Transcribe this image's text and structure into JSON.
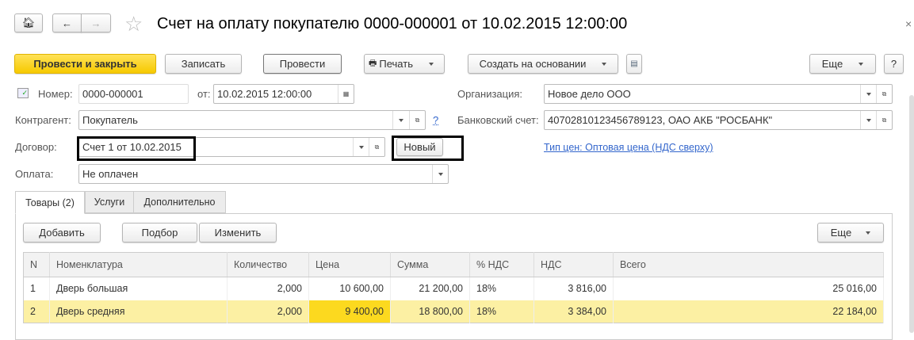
{
  "title": "Счет на оплату покупателю 0000-000001 от 10.02.2015 12:00:00",
  "toolbar": {
    "post_close": "Провести и закрыть",
    "save": "Записать",
    "post": "Провести",
    "print": "Печать",
    "create_based": "Создать на основании",
    "more": "Еще",
    "help": "?"
  },
  "form": {
    "number_label": "Номер:",
    "number": "0000-000001",
    "date_label": "от:",
    "date": "10.02.2015 12:00:00",
    "org_label": "Организация:",
    "org": "Новое дело ООО",
    "contractor_label": "Контрагент:",
    "contractor": "Покупатель",
    "help_link": "?",
    "bank_label": "Банковский счет:",
    "bank": "40702810123456789123, ОАО АКБ \"РОСБАНК\"",
    "contract_label": "Договор:",
    "contract": "Счет 1 от 10.02.2015",
    "new_button": "Новый",
    "price_type_link": "Тип цен: Оптовая цена (НДС сверху)",
    "payment_label": "Оплата:",
    "payment": "Не оплачен"
  },
  "tabs": [
    "Товары (2)",
    "Услуги",
    "Дополнительно"
  ],
  "table_toolbar": {
    "add": "Добавить",
    "pick": "Подбор",
    "edit": "Изменить",
    "more": "Еще"
  },
  "table": {
    "columns": [
      "N",
      "Номенклатура",
      "Количество",
      "Цена",
      "Сумма",
      "% НДС",
      "НДС",
      "Всего"
    ],
    "rows": [
      [
        "1",
        "Дверь большая",
        "2,000",
        "10 600,00",
        "21 200,00",
        "18%",
        "3 816,00",
        "25 016,00"
      ],
      [
        "2",
        "Дверь средняя",
        "2,000",
        "9 400,00",
        "18 800,00",
        "18%",
        "3 384,00",
        "22 184,00"
      ]
    ]
  },
  "close": "×"
}
